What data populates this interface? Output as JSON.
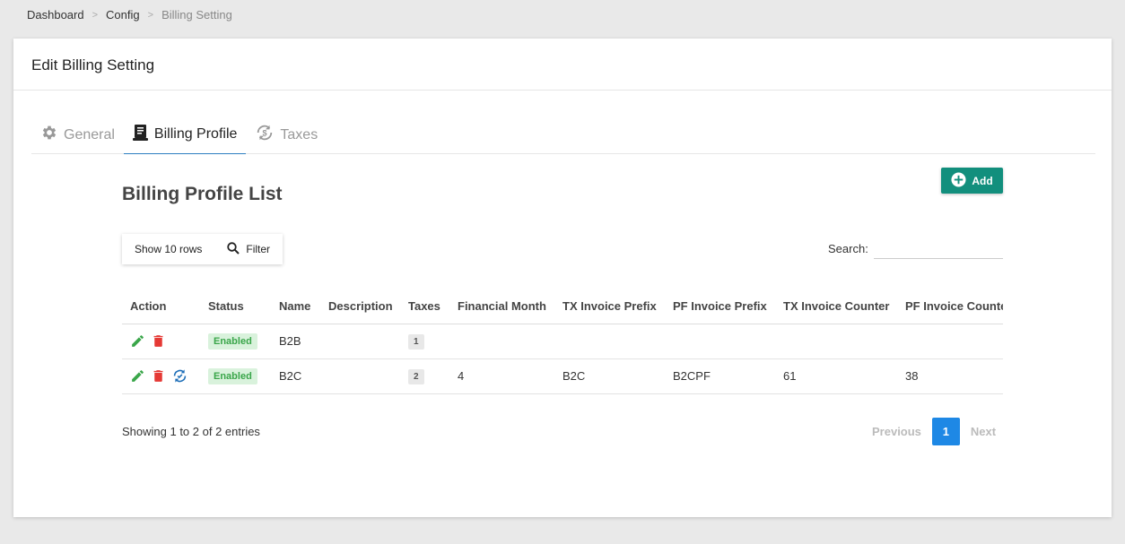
{
  "breadcrumb": [
    {
      "label": "Dashboard"
    },
    {
      "label": "Config"
    },
    {
      "label": "Billing Setting"
    }
  ],
  "breadcrumb_sep": ">",
  "card": {
    "title": "Edit Billing Setting"
  },
  "tabs": [
    {
      "label": "General",
      "icon": "gear-icon"
    },
    {
      "label": "Billing Profile",
      "icon": "receipt-icon",
      "active": true
    },
    {
      "label": "Taxes",
      "icon": "refresh-dollar-icon"
    }
  ],
  "add_button": {
    "label": "Add",
    "icon": "plus-circle-icon"
  },
  "list_title": "Billing Profile List",
  "toolbar": {
    "show_rows": "Show 10 rows",
    "filter": "Filter"
  },
  "search": {
    "label": "Search:",
    "value": ""
  },
  "table": {
    "columns": [
      "Action",
      "Status",
      "Name",
      "Description",
      "Taxes",
      "Financial Month",
      "TX Invoice Prefix",
      "PF Invoice Prefix",
      "TX Invoice Counter",
      "PF Invoice Counter"
    ],
    "rows": [
      {
        "status": "Enabled",
        "name": "B2B",
        "description": "",
        "taxes": "1",
        "financial_month": "",
        "tx_prefix": "",
        "pf_prefix": "",
        "tx_counter": "",
        "pf_counter": "",
        "sync": false
      },
      {
        "status": "Enabled",
        "name": "B2C",
        "description": "",
        "taxes": "2",
        "financial_month": "4",
        "tx_prefix": "B2C",
        "pf_prefix": "B2CPF",
        "tx_counter": "61",
        "pf_counter": "38",
        "sync": true
      }
    ]
  },
  "info": "Showing 1 to 2 of 2 entries",
  "pagination": {
    "previous": "Previous",
    "current": "1",
    "next": "Next"
  },
  "colors": {
    "accent": "#128f7d",
    "page_active": "#1e88e5",
    "edit": "#3aa64a",
    "delete": "#e53935",
    "sync": "#1e6fb8",
    "tab_underline": "#2d7fc1"
  }
}
